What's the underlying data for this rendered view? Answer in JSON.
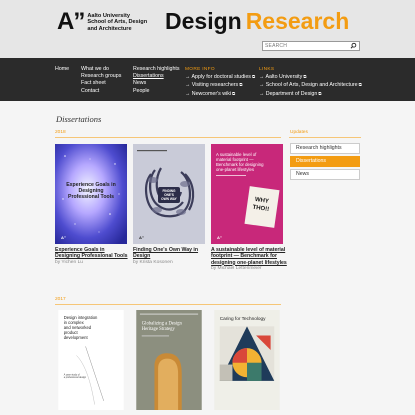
{
  "header": {
    "logo_mark": "A”",
    "logo_lines": [
      "Aalto University",
      "School of Arts, Design",
      "and Architecture"
    ],
    "title_word1": "Design",
    "title_word2": "Research",
    "search_placeholder": "SEARCH"
  },
  "nav": {
    "col1": [
      "Home"
    ],
    "col2": [
      "What we do",
      "Research groups",
      "Fact sheet",
      "Contact"
    ],
    "col3": [
      "Research highlights",
      "Dissertations",
      "News",
      "People"
    ],
    "more_info_heading": "MORE INFO",
    "more_info": [
      "→ Apply for doctoral studies",
      "→ Visiting researchers",
      "→ Newcomer's wiki"
    ],
    "links_heading": "LINKS",
    "links": [
      "→ Aalto University",
      "→ School of Arts, Design and Architecture",
      "→ Department of Design"
    ]
  },
  "main": {
    "heading": "Dissertations",
    "sections": [
      {
        "year": "2018",
        "books": [
          {
            "cover_text": "Experience Goals in Designing Professional Tools",
            "title_lines": [
              "Experience Goals in",
              "Designing Professional Tools"
            ],
            "author": "by Yichen Lu"
          },
          {
            "cover_text": "FINDING ONE'S OWN WAY IN DESIGN",
            "title_lines": [
              "Finding One's Own Way in",
              "Design"
            ],
            "author": "by Krista Kosonen"
          },
          {
            "cover_text": "A sustainable level of material footprint — Benchmark for designing one-planet lifestyles",
            "title_lines": [
              "A sustainable level of material",
              "footprint — Benchmark for",
              "designing one-planet lifestyles"
            ],
            "author": "by Michael Lettenmeier"
          }
        ]
      },
      {
        "year": "2017",
        "books": [
          {
            "cover_text": "Design integration in complex and networked product development"
          },
          {
            "cover_text": "Globalizing a Design Heritage Strategy"
          },
          {
            "cover_text": "Caring for Technology"
          }
        ]
      }
    ]
  },
  "sidebar": {
    "heading": "Updates",
    "items": [
      "Research highlights",
      "Dissertations",
      "News"
    ],
    "active_index": 1
  },
  "colors": {
    "accent": "#f39c12",
    "nav_bg": "#2b2b2b"
  }
}
